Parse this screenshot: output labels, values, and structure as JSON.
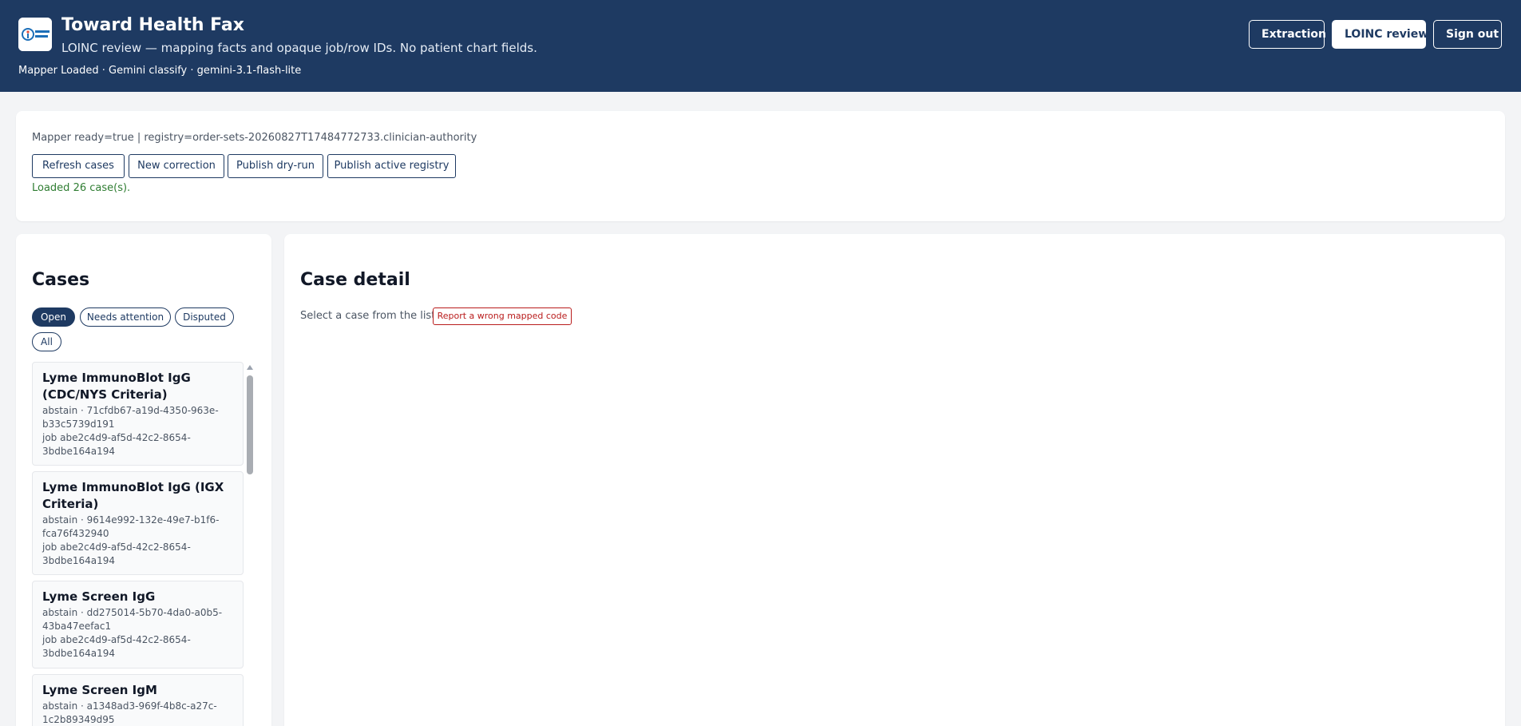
{
  "header": {
    "logo_icon": "toward-health-logo",
    "title": "Toward Health Fax",
    "subtitle": "LOINC review — mapping facts and opaque job/row IDs. No patient chart fields.",
    "status": "Mapper Loaded · Gemini classify · gemini-3.1-flash-lite",
    "nav": {
      "extraction": "Extraction",
      "loinc_review": "LOINC review",
      "sign_out": "Sign out"
    },
    "colors": {
      "background": "#1e3a62",
      "text": "#ffffff"
    }
  },
  "toolbar": {
    "mapper_status": "Mapper ready=true | registry=order-sets-20260827T17484772733.clinician-authority",
    "buttons": {
      "refresh": "Refresh cases",
      "new_correction": "New correction",
      "publish_dry_run": "Publish dry-run",
      "publish_active": "Publish active registry"
    },
    "message": "Loaded 26 case(s).",
    "message_color": "#2f7d32"
  },
  "cases": {
    "heading": "Cases",
    "filters": {
      "open": "Open",
      "needs_attention": "Needs attention",
      "disputed": "Disputed",
      "all": "All"
    },
    "active_filter": "Open",
    "items": [
      {
        "title_line1": "Lyme ImmunoBlot IgG",
        "title_line2": "(CDC/NYS Criteria)",
        "meta_line1": "abstain · 71cfdb67-a19d-4350-963e-",
        "meta_line2": "b33c5739d191",
        "job_line1": "job abe2c4d9-af5d-42c2-8654-",
        "job_line2": "3bdbe164a194"
      },
      {
        "title_line1": "Lyme ImmunoBlot IgG (IGX",
        "title_line2": "Criteria)",
        "meta_line1": "abstain · 9614e992-132e-49e7-b1f6-",
        "meta_line2": "fca76f432940",
        "job_line1": "job abe2c4d9-af5d-42c2-8654-",
        "job_line2": "3bdbe164a194"
      },
      {
        "title_line1": "Lyme Screen IgG",
        "meta_line1": "abstain · dd275014-5b70-4da0-a0b5-",
        "meta_line2": "43ba47eefac1",
        "job_line1": "job abe2c4d9-af5d-42c2-8654-",
        "job_line2": "3bdbe164a194"
      },
      {
        "title_line1": "Lyme Screen IgM",
        "meta_line1": "abstain · a1348ad3-969f-4b8c-a27c-",
        "meta_line2": "1c2b89349d95"
      }
    ]
  },
  "detail": {
    "heading": "Case detail",
    "hint": "Select a case from the list.",
    "report_button": "Report a wrong mapped code",
    "report_color": "#b91c1c"
  }
}
